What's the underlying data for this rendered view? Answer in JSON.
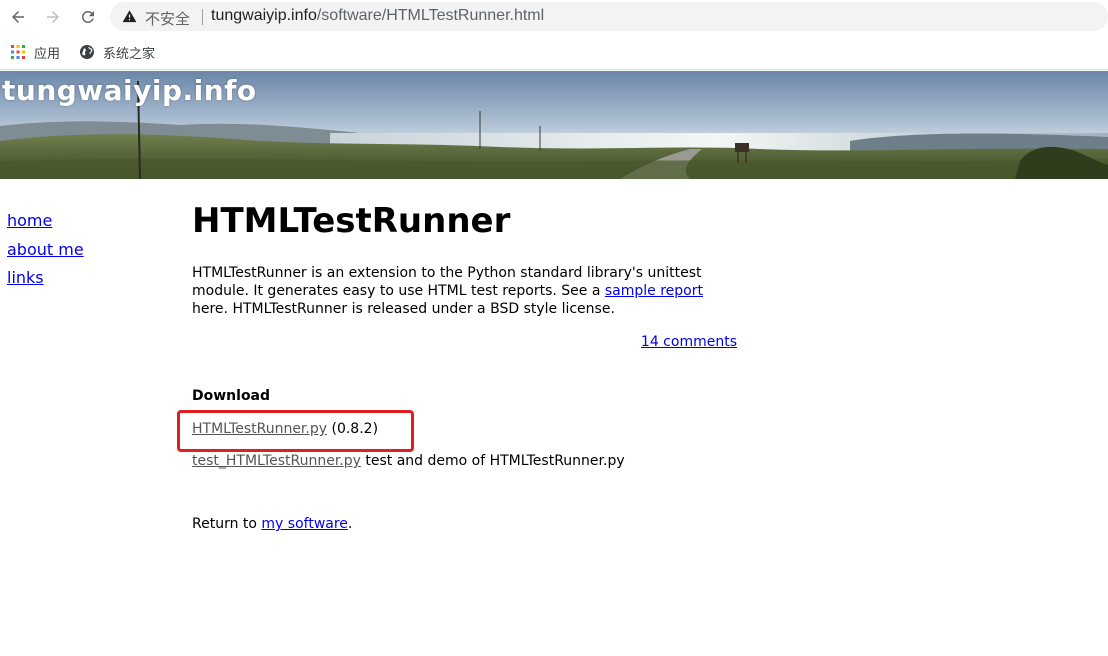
{
  "browser": {
    "security_label": "不安全",
    "url_host": "tungwaiyip.info",
    "url_path": "/software/HTMLTestRunner.html",
    "bookmarks": [
      {
        "label": "应用",
        "icon": "apps-grid-icon"
      },
      {
        "label": "系统之家",
        "icon": "globe-icon"
      }
    ]
  },
  "site": {
    "title": "tungwaiyip.info"
  },
  "sidebar": {
    "items": [
      {
        "label": "home"
      },
      {
        "label": "about me"
      },
      {
        "label": "links"
      }
    ]
  },
  "main": {
    "title": "HTMLTestRunner",
    "intro_part1": "HTMLTestRunner is an extension to the Python standard library's unittest module. It generates easy to use HTML test reports. See a ",
    "intro_link": "sample report",
    "intro_part2": " here. HTMLTestRunner is released under a BSD style license.",
    "comments_link": "14 comments",
    "download_heading": "Download",
    "download1_link": "HTMLTestRunner.py",
    "download1_version": " (0.8.2)",
    "download2_link": "test_HTMLTestRunner.py",
    "download2_desc": " test and demo of HTMLTestRunner.py",
    "return_prefix": "Return to ",
    "return_link": "my software",
    "return_suffix": "."
  },
  "colors": {
    "link": "#0000ee",
    "visited_link": "#555555",
    "highlight": "#e02020"
  }
}
